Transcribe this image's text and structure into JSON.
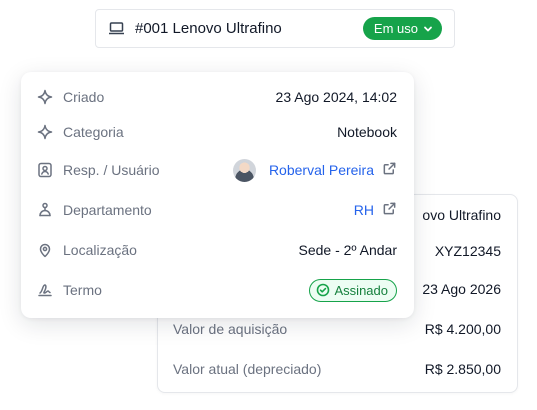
{
  "header": {
    "title": "#001  Lenovo Ultrafino",
    "status": "Em uso",
    "status_color": "#16a34a",
    "icon": "laptop-icon"
  },
  "details": {
    "criado": {
      "label": "Criado",
      "value": "23 Ago 2024, 14:02",
      "icon": "sparkle-icon"
    },
    "categoria": {
      "label": "Categoria",
      "value": "Notebook",
      "icon": "sparkle-icon"
    },
    "responsavel": {
      "label": "Resp. / Usuário",
      "value": "Roberval Pereira",
      "icon": "user-badge-icon"
    },
    "departamento": {
      "label": "Departamento",
      "value": "RH",
      "icon": "network-icon"
    },
    "localizacao": {
      "label": "Localização",
      "value": "Sede - 2º Andar",
      "icon": "location-pin-icon"
    },
    "termo": {
      "label": "Termo",
      "value": "Assinado",
      "icon": "signature-icon"
    }
  },
  "back_card": {
    "model_partial": "ovo Ultrafino",
    "serial": "XYZ12345",
    "date_partial": "23 Ago 2026",
    "aquisicao": {
      "label": "Valor de aquisição",
      "value": "R$ 4.200,00"
    },
    "atual": {
      "label": "Valor atual (depreciado)",
      "value": "R$ 2.850,00"
    }
  },
  "colors": {
    "link": "#2563eb",
    "success": "#16a34a",
    "muted": "#6b7280"
  }
}
